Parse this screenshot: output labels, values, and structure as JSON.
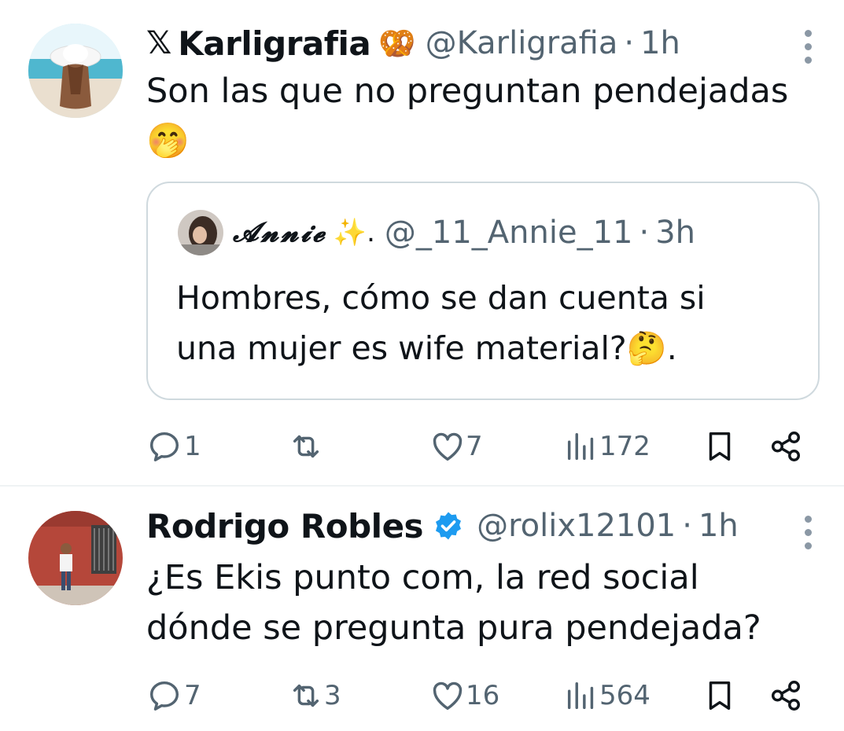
{
  "tweets": [
    {
      "x_logo": "𝕏",
      "name": "Karligrafia",
      "name_emoji": "🥨",
      "handle": "@Karligrafia",
      "dot": "·",
      "time": "1h",
      "text_line1": "Son las que no preguntan pendejadas",
      "text_line2": "🤭",
      "quote": {
        "name": "𝓐𝓷𝓷𝓲𝓮",
        "name_emoji": "✨.",
        "handle": "@_11_Annie_11",
        "dot": "·",
        "time": "3h",
        "text_line1": "Hombres, cómo se dan cuenta si",
        "text_line2": "una mujer es wife material?🤔."
      },
      "actions": {
        "replies": "1",
        "reposts": "",
        "likes": "7",
        "views": "172"
      }
    },
    {
      "name": "Rodrigo Robles",
      "handle": "@rolix12101",
      "dot": "·",
      "time": "1h",
      "text_line1": "¿Es Ekis punto com, la red social",
      "text_line2": "dónde se pregunta pura pendejada?",
      "actions": {
        "replies": "7",
        "reposts": "3",
        "likes": "16",
        "views": "564"
      }
    }
  ],
  "colors": {
    "secondary": "#536471",
    "verified": "#1d9bf0",
    "border": "#cfd9de",
    "divider": "#eff3f4"
  },
  "icons": [
    "reply-icon",
    "repost-icon",
    "like-icon",
    "views-icon",
    "bookmark-icon",
    "share-icon",
    "more-icon",
    "verified-icon"
  ]
}
